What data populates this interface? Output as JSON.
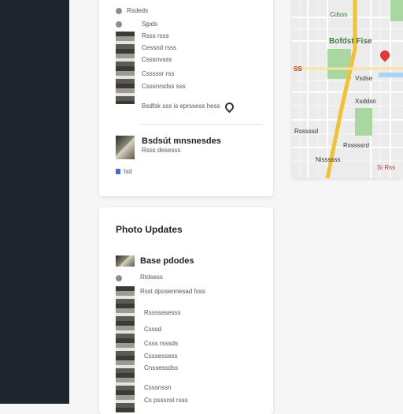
{
  "top_card": {
    "rows": [
      "Rsdeds",
      "Sjpds",
      "Rsss rsss",
      "Cessnd rsss",
      "Csssnvsss",
      "Csssssr rss",
      "Csssnrsdss sss"
    ],
    "location_row": "Bsdfsk sss is eprssess hess",
    "featured_title": "Bsdsút mnsnesdes",
    "featured_sub": "Rsss desesss",
    "footer_link": "Isd"
  },
  "bottom_card": {
    "title": "Photo Updates",
    "featured_title": "Base pdodes",
    "row_header": "Rtdsess",
    "row_sub": "Rsst dposennesad fsss",
    "rows": [
      "Rssssasesss",
      "Csssd",
      "Csss rsssds",
      "Csssessess",
      "Cnssessdss",
      "Csssnssn",
      "Cs psssnsl rsss"
    ]
  },
  "map": {
    "labels": {
      "top_right": "Cdsss",
      "park": "Bofdst Fise",
      "left_marker": "SS",
      "center": "Vsdse",
      "mid": "Xsddsn",
      "right_mid": "Rsssssd",
      "lower": "Rsssssrd",
      "bottom": "Nissssss",
      "bottom_right": "Si Rss"
    },
    "colors": {
      "road": "#f1c232",
      "park": "#a8d8a0",
      "water": "#a9d4f5",
      "pin": "#e53935"
    }
  }
}
